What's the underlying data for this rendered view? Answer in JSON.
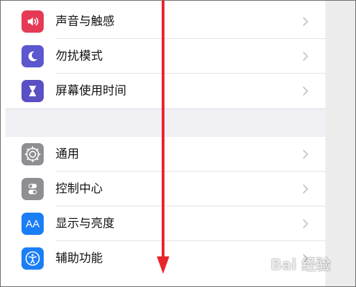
{
  "settings_list": {
    "group1": [
      {
        "label": "声音与触感",
        "icon": "speaker-icon",
        "color": "#e53a55"
      },
      {
        "label": "勿扰模式",
        "icon": "moon-icon",
        "color": "#5b57cf"
      },
      {
        "label": "屏幕使用时间",
        "icon": "hourglass-icon",
        "color": "#5b4fc4"
      }
    ],
    "group2": [
      {
        "label": "通用",
        "icon": "gear-icon",
        "color": "#8e8e93"
      },
      {
        "label": "控制中心",
        "icon": "toggles-icon",
        "color": "#8e8e93"
      },
      {
        "label": "显示与亮度",
        "icon": "text-size-icon",
        "color": "#1a7ef5",
        "glyph": "AA"
      },
      {
        "label": "辅助功能",
        "icon": "accessibility-icon",
        "color": "#1a7ef5"
      }
    ]
  },
  "annotation": {
    "icon": "down-arrow-icon",
    "color": "#e9252b"
  },
  "watermark": {
    "text": "Bai 经验"
  }
}
